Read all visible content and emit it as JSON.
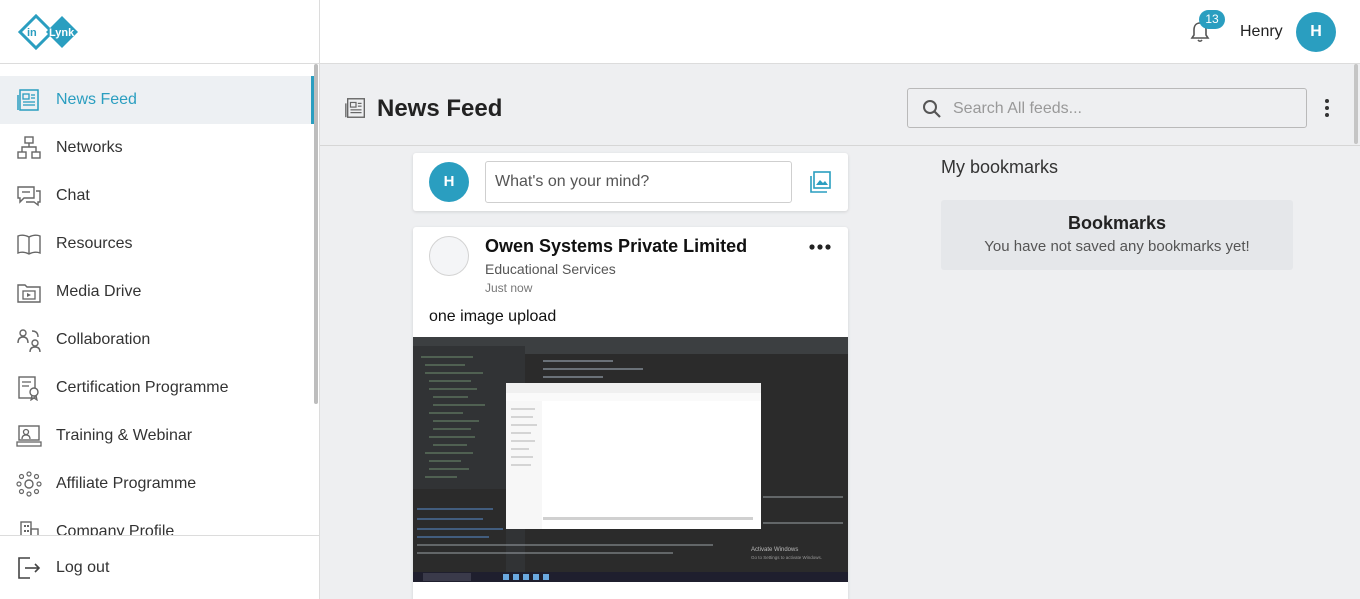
{
  "brand": {
    "logo_text_in": "in",
    "logo_text_lynk": "Lynk",
    "accent": "#2a9ec0"
  },
  "topbar": {
    "notification_count": "13",
    "user_name": "Henry",
    "avatar_initial": "H"
  },
  "sidebar": {
    "items": [
      {
        "label": "News Feed",
        "icon": "newspaper-icon",
        "active": true
      },
      {
        "label": "Networks",
        "icon": "network-icon"
      },
      {
        "label": "Chat",
        "icon": "chat-icon"
      },
      {
        "label": "Resources",
        "icon": "book-icon"
      },
      {
        "label": "Media Drive",
        "icon": "media-folder-icon"
      },
      {
        "label": "Collaboration",
        "icon": "collaboration-icon"
      },
      {
        "label": "Certification Programme",
        "icon": "certificate-icon"
      },
      {
        "label": "Training & Webinar",
        "icon": "webinar-icon"
      },
      {
        "label": "Affiliate Programme",
        "icon": "affiliate-icon"
      },
      {
        "label": "Company Profile",
        "icon": "building-icon"
      }
    ],
    "logout_label": "Log out"
  },
  "header": {
    "title": "News Feed",
    "search_placeholder": "Search All feeds..."
  },
  "composer": {
    "avatar_initial": "H",
    "placeholder": "What's on your mind?"
  },
  "post": {
    "author": "Owen Systems Private Limited",
    "category": "Educational Services",
    "time": "Just now",
    "text": "one image upload",
    "image_overlay": {
      "activate_title": "Activate Windows",
      "activate_sub": "Go to Settings to activate Windows."
    }
  },
  "bookmarks": {
    "heading": "My bookmarks",
    "title": "Bookmarks",
    "empty_text": "You have not saved any bookmarks yet!"
  }
}
